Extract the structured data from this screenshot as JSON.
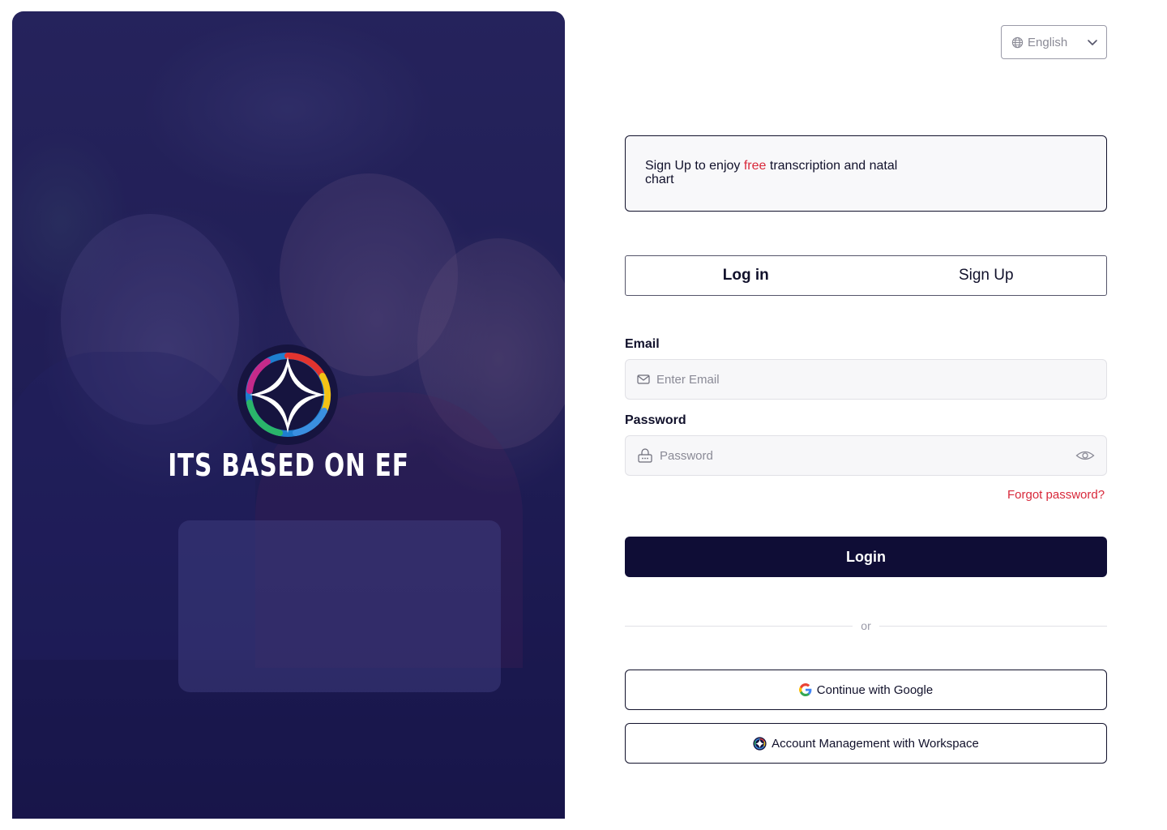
{
  "hero": {
    "brand_text": "ITS BASED ON EF",
    "logo_icon": "four-point-star-ring-logo"
  },
  "language": {
    "icon": "globe-icon",
    "value": "English",
    "chevron": "chevron-down-icon"
  },
  "promo": {
    "text_before": "Sign Up to enjoy ",
    "text_accent": "free",
    "text_after": " transcription and natal chart",
    "accent_color": "#d8283a"
  },
  "tabs": [
    {
      "label": "Log in",
      "active": true
    },
    {
      "label": "Sign Up",
      "active": false
    }
  ],
  "form": {
    "email_label": "Email",
    "email_placeholder": "Enter Email",
    "password_label": "Password",
    "password_placeholder": "Password",
    "forgot_label": "Forgot password?",
    "login_label": "Login",
    "divider_label": "or"
  },
  "oauth": {
    "google_label": "Continue with Google",
    "workspace_label": "Account Management with Workspace"
  },
  "colors": {
    "primary": "#0f0d36",
    "accent": "#d8283a"
  }
}
